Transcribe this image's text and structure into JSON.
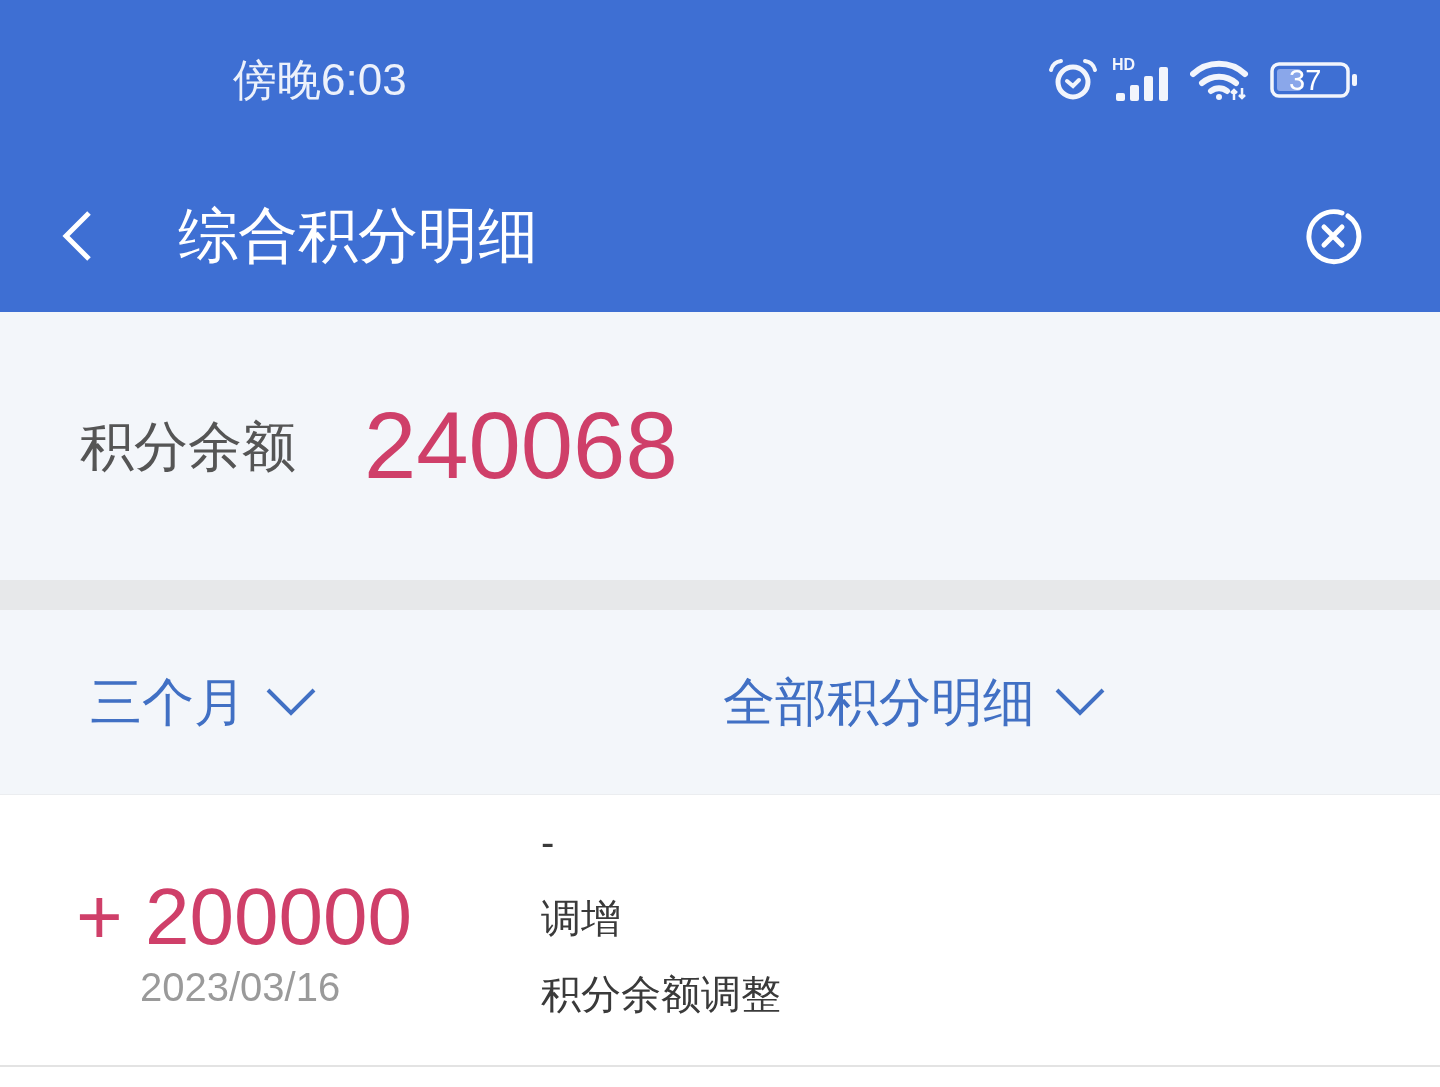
{
  "status_bar": {
    "time": "傍晚6:03",
    "network_label": "HD",
    "battery": "37"
  },
  "header": {
    "title": "综合积分明细"
  },
  "balance": {
    "label": "积分余额",
    "value": "240068"
  },
  "filters": [
    {
      "label": "三个月"
    },
    {
      "label": "全部积分明细"
    }
  ],
  "records": [
    {
      "amount": "+ 200000",
      "date": "2023/03/16",
      "lines": [
        "-",
        "调增",
        "积分余额调整"
      ]
    }
  ]
}
